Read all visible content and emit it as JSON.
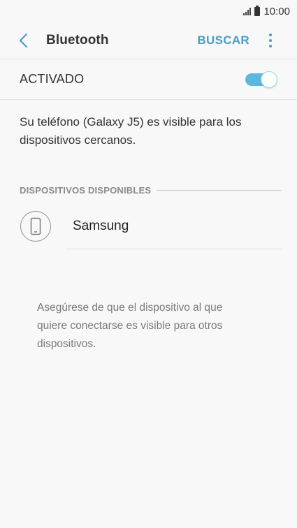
{
  "status_bar": {
    "time": "10:00"
  },
  "header": {
    "title": "Bluetooth",
    "search_label": "BUSCAR"
  },
  "toggle": {
    "label": "ACTIVADO",
    "state": "on"
  },
  "visibility_text": "Su teléfono (Galaxy J5) es visible para los dispositivos cercanos.",
  "available_devices": {
    "title": "DISPOSITIVOS DISPONIBLES",
    "items": [
      {
        "name": "Samsung",
        "icon": "phone-icon"
      }
    ]
  },
  "hint": "Asegúrese de que el dispositivo al que quiere conectarse es visible para otros dispositivos.",
  "colors": {
    "accent": "#4a9cc7",
    "switch_on": "#5bb7e0",
    "background": "#f8f8f8"
  }
}
